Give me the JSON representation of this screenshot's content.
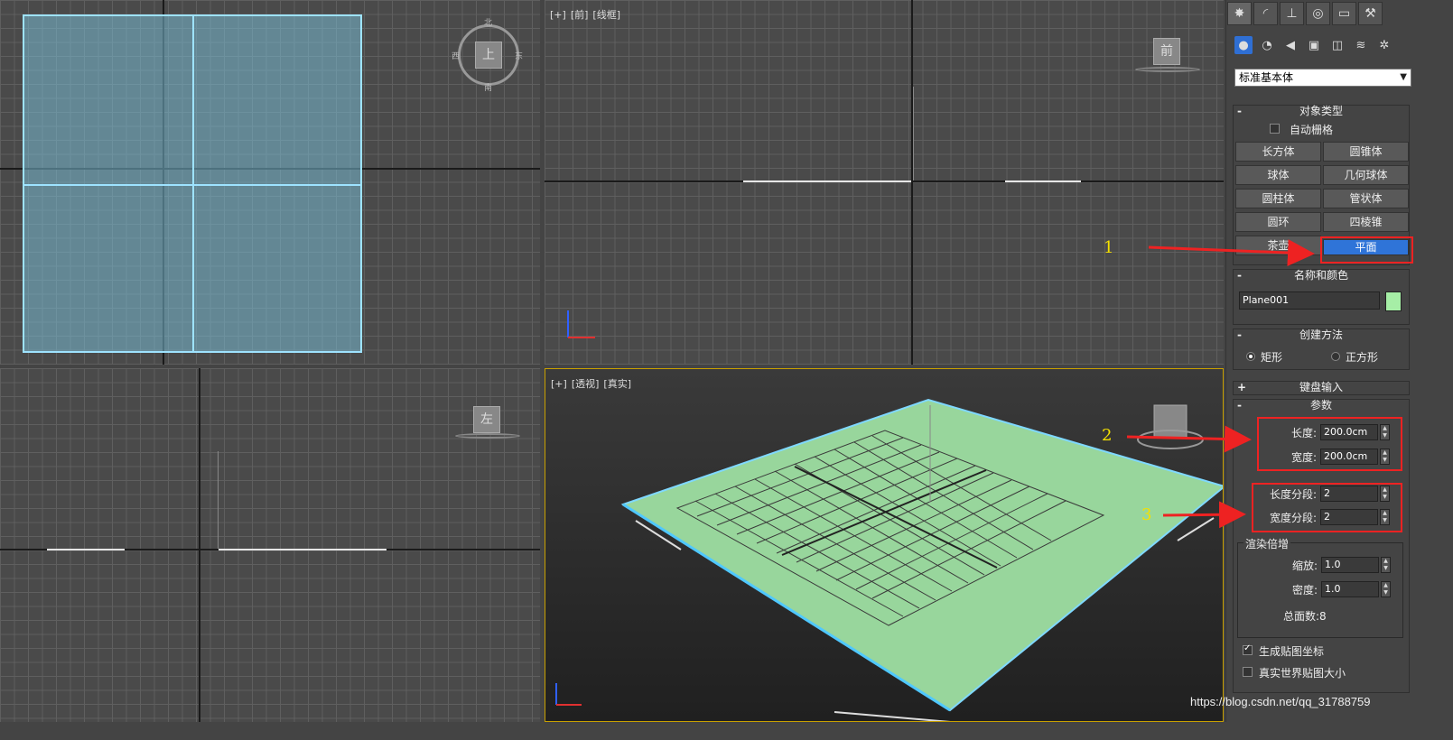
{
  "viewports": {
    "top": {
      "cube_label": "上",
      "compass": [
        "北",
        "西",
        "东",
        "南"
      ]
    },
    "front": {
      "label": [
        "[+]",
        "[前]",
        "[线框]"
      ],
      "cube_label": "前"
    },
    "left": {
      "cube_label": "左"
    },
    "perspective": {
      "label": [
        "[+]",
        "[透视]",
        "[真实]"
      ]
    }
  },
  "panel": {
    "tabs": [
      "create-icon",
      "modify-icon",
      "hierarchy-icon",
      "motion-icon",
      "display-icon",
      "utilities-icon"
    ],
    "category_dropdown": "标准基本体",
    "object_type": {
      "title": "对象类型",
      "toggle": "-",
      "autogrid": "自动栅格",
      "buttons": [
        "长方体",
        "圆锥体",
        "球体",
        "几何球体",
        "圆柱体",
        "管状体",
        "圆环",
        "四棱锥",
        "茶壶",
        "平面"
      ],
      "active": "平面"
    },
    "name_color": {
      "title": "名称和颜色",
      "toggle": "-",
      "name": "Plane001",
      "color": "#a6eea6"
    },
    "creation_method": {
      "title": "创建方法",
      "toggle": "-",
      "options": [
        "矩形",
        "正方形"
      ],
      "selected": "矩形"
    },
    "keyboard_entry": {
      "title": "键盘输入",
      "toggle": "+"
    },
    "parameters": {
      "title": "参数",
      "toggle": "-",
      "length_label": "长度:",
      "length": "200.0cm",
      "width_label": "宽度:",
      "width": "200.0cm",
      "length_segs_label": "长度分段:",
      "length_segs": "2",
      "width_segs_label": "宽度分段:",
      "width_segs": "2",
      "render_multipliers": {
        "title": "渲染倍增",
        "scale_label": "缩放:",
        "scale": "1.0",
        "density_label": "密度:",
        "density": "1.0",
        "total_faces": "总面数:8"
      },
      "gen_map_coords": "生成贴图坐标",
      "real_world_map": "真实世界贴图大小"
    }
  },
  "annotations": [
    "1",
    "2",
    "3"
  ],
  "watermark": "https://blog.csdn.net/qq_31788759",
  "colors": {
    "plane_fill": "#98d69c",
    "active_button": "#2f74d8",
    "annotation_red": "#ee2222",
    "annotation_num": "#f5e100"
  }
}
